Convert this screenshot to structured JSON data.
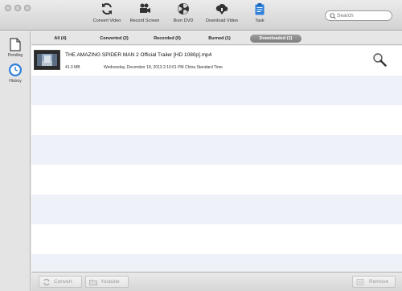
{
  "toolbar": {
    "items": [
      {
        "label": "Convert Video",
        "icon": "convert-icon"
      },
      {
        "label": "Record Screen",
        "icon": "camera-icon"
      },
      {
        "label": "Burn DVD",
        "icon": "disc-icon"
      },
      {
        "label": "Download Video",
        "icon": "download-icon"
      },
      {
        "label": "Task",
        "icon": "clipboard-icon"
      }
    ],
    "search_placeholder": "Search"
  },
  "sidebar": {
    "items": [
      {
        "label": "Pending",
        "icon": "document-icon"
      },
      {
        "label": "History",
        "icon": "clock-icon"
      }
    ]
  },
  "tabs": [
    {
      "label": "All (4)"
    },
    {
      "label": "Converted (2)"
    },
    {
      "label": "Recorded (0)"
    },
    {
      "label": "Burned (1)"
    },
    {
      "label": "Downloaded (1)"
    }
  ],
  "files": [
    {
      "name": "THE AMAZING SPIDER MAN 2 Official Trailer [HD 1080p].mp4",
      "size": "41.0 MB",
      "date": "Wednesday, December 18, 2013 2:10:01 PM China Standard Time"
    }
  ],
  "footer": {
    "convert": "Convert",
    "youtube": "Youtube",
    "remove": "Remove"
  },
  "colors": {
    "accent": "#2d7fd9",
    "active_tab": "#8a8a8a",
    "row_stripe": "#eef2f8"
  }
}
